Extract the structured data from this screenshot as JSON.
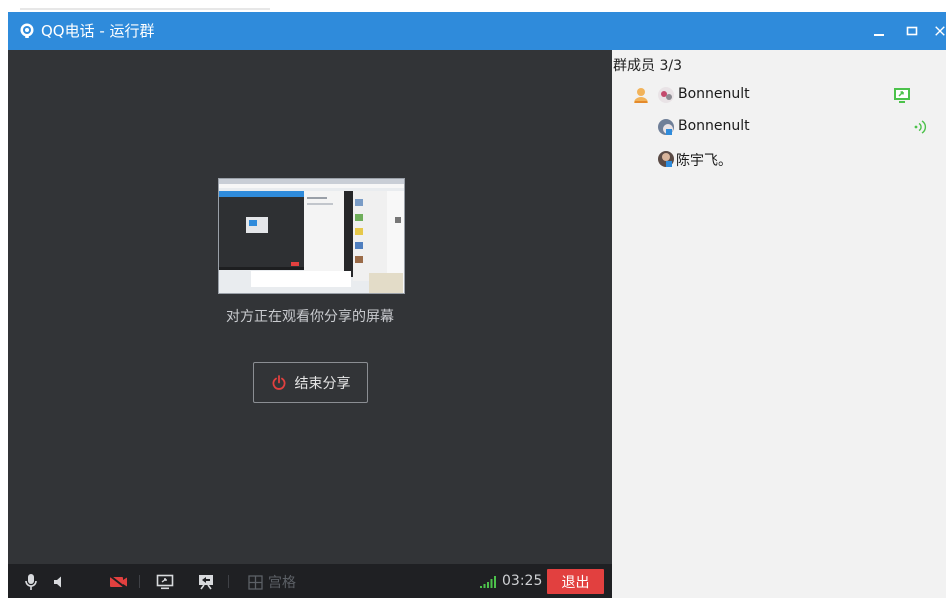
{
  "window": {
    "title": "QQ电话 - 运行群",
    "accent_color": "#2f8bdb"
  },
  "stage": {
    "share_status": "对方正在观看你分享的屏幕",
    "end_share_label": "结束分享"
  },
  "toolbar": {
    "grid_label": "宫格",
    "timer": "03:25",
    "exit_label": "退出",
    "icons": [
      "microphone-icon",
      "speaker-icon",
      "camera-off-icon",
      "screen-share-icon",
      "share-video-icon",
      "grid-icon",
      "signal-icon"
    ]
  },
  "members": {
    "count_label": "群成员 3/3",
    "items": [
      {
        "name": "Bonnenult",
        "role": "host",
        "status_icon": "screen-share-icon"
      },
      {
        "name": "Bonnenult",
        "status_icon": "speaking-icon"
      },
      {
        "name": "陈宇飞。"
      }
    ]
  }
}
